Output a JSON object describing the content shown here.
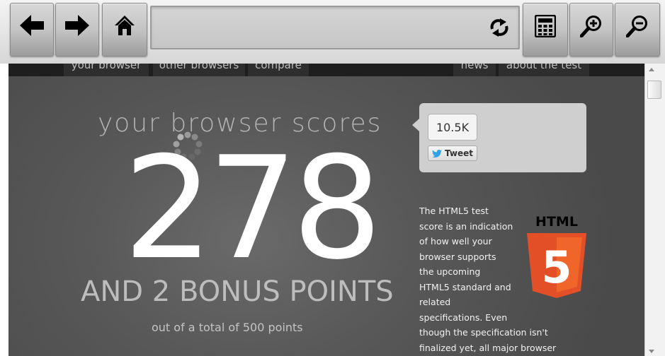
{
  "toolbar": {
    "back_icon": "arrow-left-icon",
    "forward_icon": "arrow-right-icon",
    "home_icon": "home-icon",
    "reload_icon": "reload-icon",
    "calculator_icon": "calculator-icon",
    "zoom_in_icon": "zoom-in-icon",
    "zoom_out_icon": "zoom-out-icon"
  },
  "urlbar": {
    "value": "",
    "placeholder": ""
  },
  "site_nav": {
    "tabs": [
      {
        "label": "your browser"
      },
      {
        "label": "other browsers"
      },
      {
        "label": "compare"
      },
      {
        "label": "news"
      },
      {
        "label": "about the test"
      }
    ]
  },
  "score_panel": {
    "headline": "your browser scores",
    "score": "278",
    "bonus": "AND 2 BONUS POINTS",
    "total": "out of a total of 500 points"
  },
  "tweet": {
    "count": "10.5K",
    "button_label": "Tweet"
  },
  "description": {
    "lines": [
      "The HTML5 test",
      "score is an indication",
      "of how well your",
      "browser supports",
      "the upcoming",
      "HTML5 standard and",
      "related",
      "specifications. Even",
      "though the specification isn't",
      "finalized yet, all major browser"
    ]
  },
  "logo": {
    "text": "HTML",
    "number": "5"
  },
  "colors": {
    "page_bg": "#555555",
    "score_text": "#ffffff",
    "html5_orange": "#e34f26",
    "toolbar_button": "#c4c4c4"
  }
}
